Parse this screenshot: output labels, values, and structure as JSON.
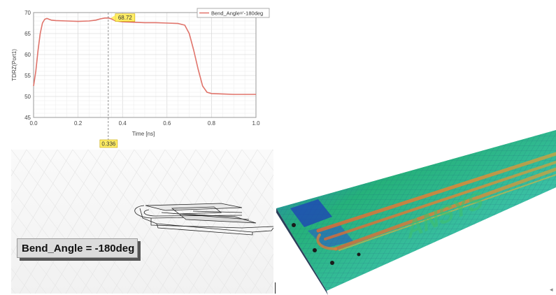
{
  "chart_data": {
    "type": "line",
    "xlabel": "Time [ns]",
    "ylabel": "TDRZ(Port1)",
    "xlim": [
      0,
      1.0
    ],
    "ylim": [
      45,
      70
    ],
    "xticks": [
      "0.0",
      "0.2",
      "0.4",
      "0.6",
      "0.8",
      "1.0"
    ],
    "yticks": [
      "45",
      "50",
      "55",
      "60",
      "65",
      "70"
    ],
    "grid": true,
    "legend_placement": "top-right",
    "series": [
      {
        "name": "Bend_Angle='-180deg",
        "color": "#e0736a",
        "x": [
          0,
          0.01,
          0.02,
          0.03,
          0.04,
          0.05,
          0.06,
          0.07,
          0.08,
          0.1,
          0.15,
          0.2,
          0.25,
          0.28,
          0.3,
          0.32,
          0.336,
          0.35,
          0.37,
          0.4,
          0.45,
          0.5,
          0.55,
          0.6,
          0.65,
          0.68,
          0.7,
          0.72,
          0.74,
          0.76,
          0.78,
          0.8,
          0.85,
          0.9,
          0.95,
          1.0
        ],
        "y": [
          52.5,
          56,
          61,
          65,
          67.5,
          68.4,
          68.6,
          68.4,
          68.2,
          68.1,
          68.0,
          67.9,
          68.0,
          68.2,
          68.5,
          68.7,
          68.72,
          68.5,
          68.0,
          67.8,
          67.7,
          67.6,
          67.6,
          67.5,
          67.4,
          67.0,
          65.0,
          61.0,
          56.5,
          52.5,
          51.0,
          50.7,
          50.6,
          50.5,
          50.5,
          50.5
        ]
      }
    ],
    "marker": {
      "x_label": "0.336",
      "y_label": "68.72",
      "x": 0.336,
      "y": 68.72
    }
  },
  "geometry_label": "Bend_Angle = -180deg",
  "watermark": "ANSYS",
  "colors": {
    "accent": "#e0736a",
    "marker_box": "#ffee66",
    "grid": "#dcdcdc"
  }
}
